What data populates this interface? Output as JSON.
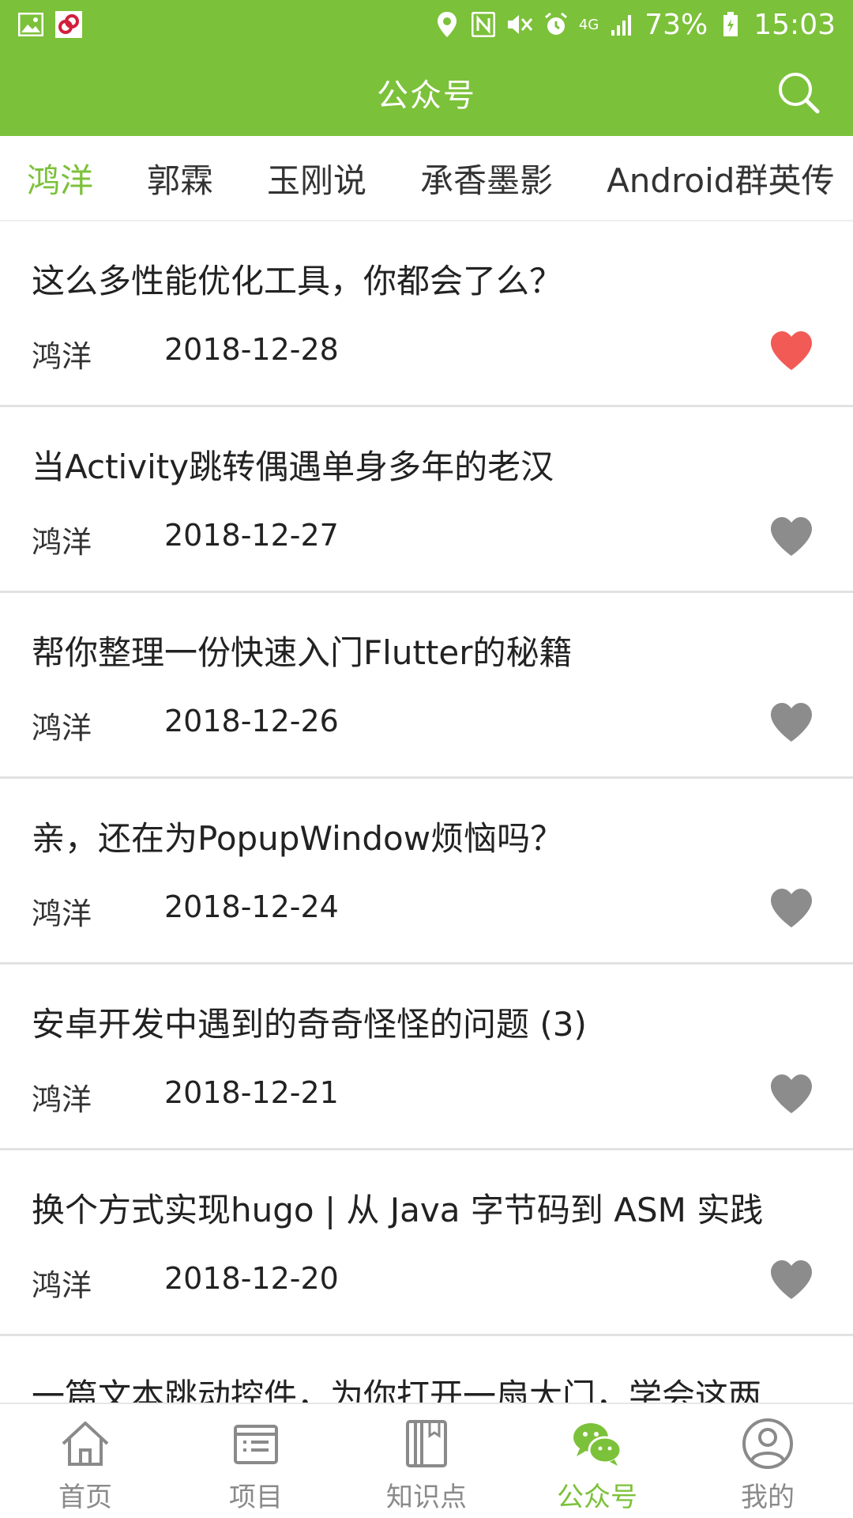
{
  "status_bar": {
    "battery": "73%",
    "time": "15:03",
    "network": "4G",
    "icons": [
      "gallery-icon",
      "link-app-icon",
      "location-icon",
      "nfc-icon",
      "mute-icon",
      "alarm-icon",
      "signal-icon",
      "battery-icon"
    ]
  },
  "app_bar": {
    "title": "公众号",
    "search_icon": "search-icon"
  },
  "tabs": [
    {
      "label": "鸿洋",
      "active": true
    },
    {
      "label": "郭霖",
      "active": false
    },
    {
      "label": "玉刚说",
      "active": false
    },
    {
      "label": "承香墨影",
      "active": false
    },
    {
      "label": "Android群英传",
      "active": false
    }
  ],
  "articles": [
    {
      "title": "这么多性能优化工具，你都会了么？",
      "author": "鸿洋",
      "date": "2018-12-28",
      "liked": true
    },
    {
      "title": "当Activity跳转偶遇单身多年的老汉",
      "author": "鸿洋",
      "date": "2018-12-27",
      "liked": false
    },
    {
      "title": "帮你整理一份快速入门Flutter的秘籍",
      "author": "鸿洋",
      "date": "2018-12-26",
      "liked": false
    },
    {
      "title": "亲，还在为PopupWindow烦恼吗？",
      "author": "鸿洋",
      "date": "2018-12-24",
      "liked": false
    },
    {
      "title": "安卓开发中遇到的奇奇怪怪的问题 (3)",
      "author": "鸿洋",
      "date": "2018-12-21",
      "liked": false
    },
    {
      "title": "换个方式实现hugo | 从 Java 字节码到 ASM 实践",
      "author": "鸿洋",
      "date": "2018-12-20",
      "liked": false
    },
    {
      "title": "一篇文本跳动控件，为你打开一扇大门，学会这两",
      "author": "",
      "date": "",
      "liked": false
    }
  ],
  "colors": {
    "accent": "#7cc13a",
    "liked": "#f25a55",
    "unliked": "#8c8c8c"
  },
  "bottom_nav": [
    {
      "label": "首页",
      "icon": "home-icon",
      "active": false
    },
    {
      "label": "项目",
      "icon": "project-icon",
      "active": false
    },
    {
      "label": "知识点",
      "icon": "knowledge-icon",
      "active": false
    },
    {
      "label": "公众号",
      "icon": "wechat-icon",
      "active": true
    },
    {
      "label": "我的",
      "icon": "profile-icon",
      "active": false
    }
  ]
}
